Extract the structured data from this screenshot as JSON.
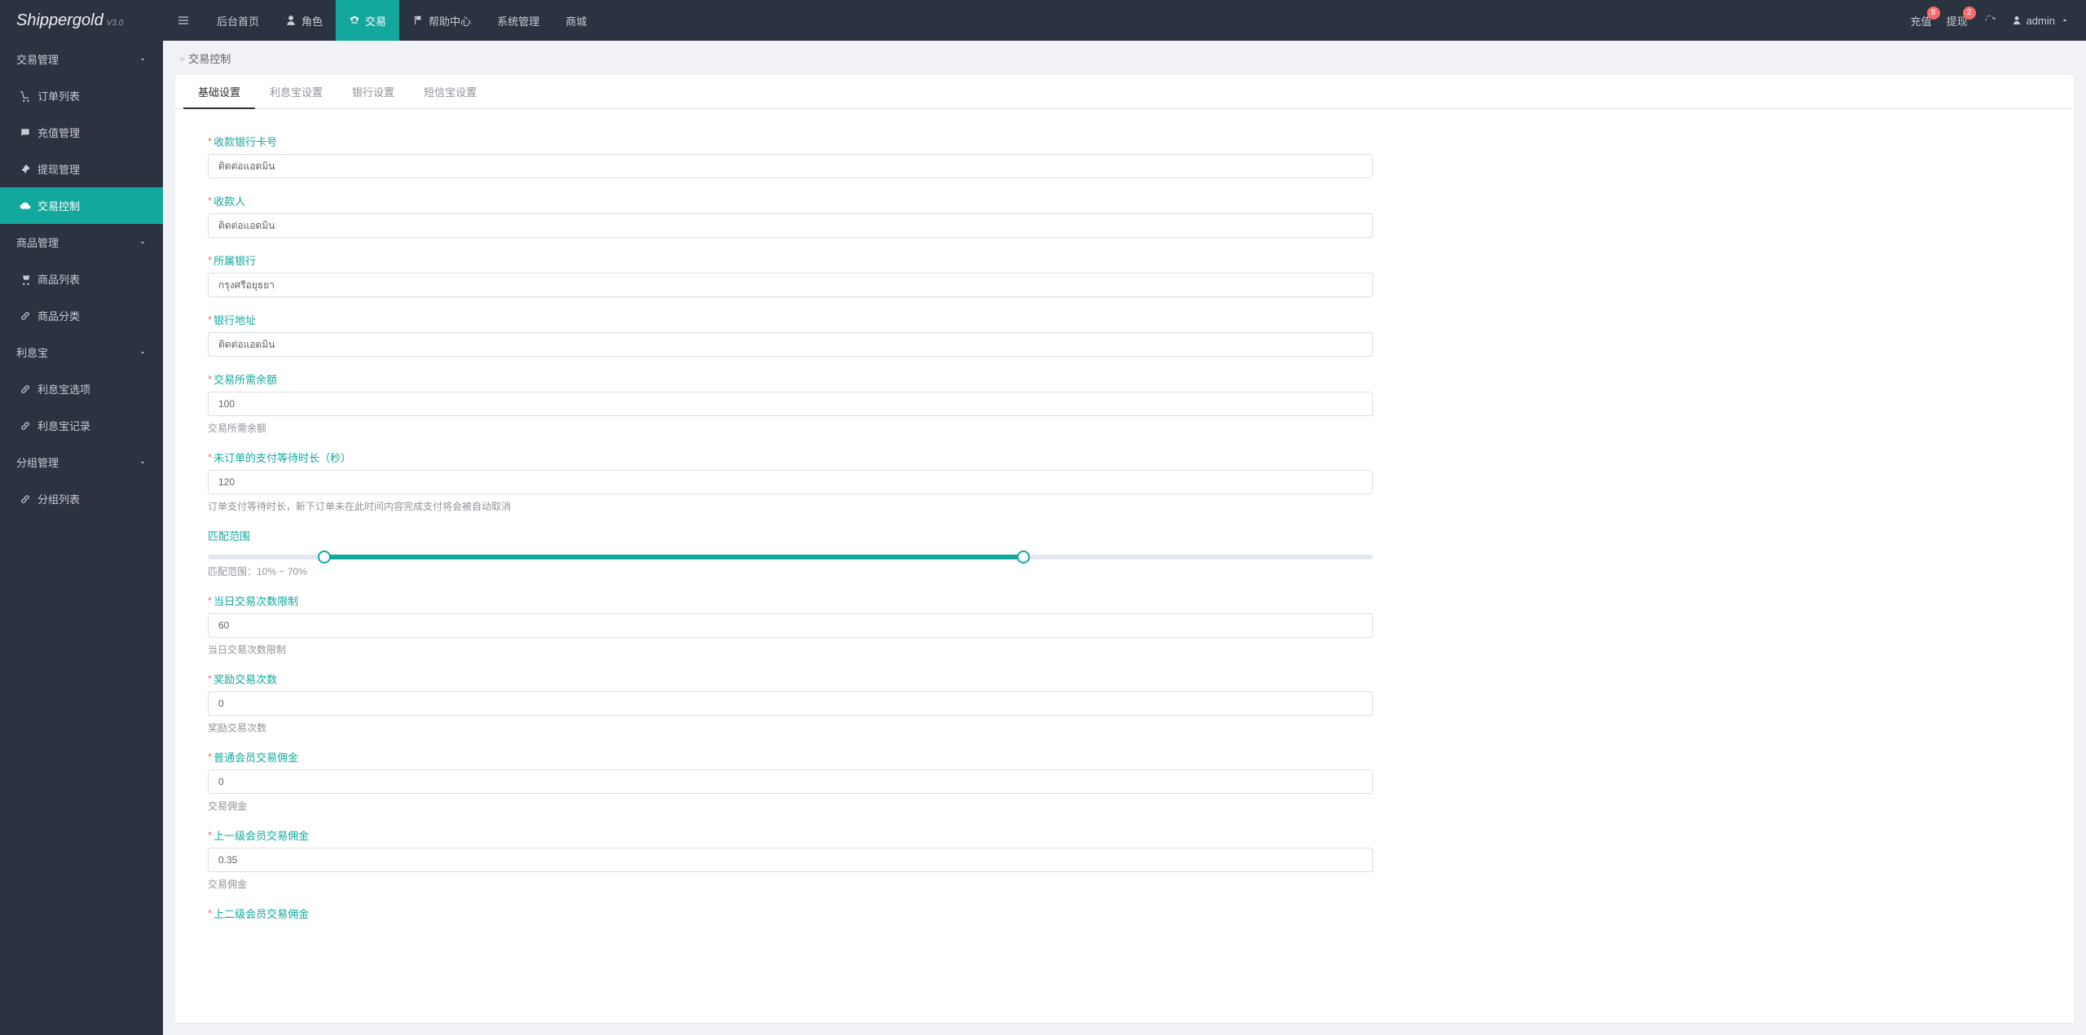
{
  "brand": {
    "name": "Shippergold",
    "version": "V3.0"
  },
  "topMenu": {
    "items": [
      {
        "label": "后台首页",
        "icon": ""
      },
      {
        "label": "角色",
        "icon": "user"
      },
      {
        "label": "交易",
        "icon": "scale",
        "active": true
      },
      {
        "label": "帮助中心",
        "icon": "flag"
      },
      {
        "label": "系统管理",
        "icon": ""
      },
      {
        "label": "商城",
        "icon": ""
      }
    ]
  },
  "navRight": {
    "recharge": {
      "label": "充值",
      "badge": "8"
    },
    "withdraw": {
      "label": "提现",
      "badge": "2"
    },
    "user": "admin"
  },
  "sidebar": {
    "groups": [
      {
        "title": "交易管理",
        "items": [
          {
            "label": "订单列表",
            "icon": "cart"
          },
          {
            "label": "充值管理",
            "icon": "chat"
          },
          {
            "label": "提现管理",
            "icon": "pin"
          },
          {
            "label": "交易控制",
            "icon": "cloud",
            "active": true
          }
        ]
      },
      {
        "title": "商品管理",
        "items": [
          {
            "label": "商品列表",
            "icon": "cart2"
          },
          {
            "label": "商品分类",
            "icon": "link"
          }
        ]
      },
      {
        "title": "利息宝",
        "items": [
          {
            "label": "利息宝选项",
            "icon": "link"
          },
          {
            "label": "利息宝记录",
            "icon": "link"
          }
        ]
      },
      {
        "title": "分组管理",
        "items": [
          {
            "label": "分组列表",
            "icon": "link"
          }
        ]
      }
    ]
  },
  "breadcrumb": {
    "sep": "»",
    "current": "交易控制"
  },
  "tabs": [
    {
      "label": "基础设置",
      "active": true
    },
    {
      "label": "利息宝设置"
    },
    {
      "label": "银行设置"
    },
    {
      "label": "短信宝设置"
    }
  ],
  "form": {
    "bank_card": {
      "label": "收款银行卡号",
      "value": "ติดต่อแอดมิน",
      "required": true
    },
    "payee": {
      "label": "收款人",
      "value": "ติดต่อแอดมิน",
      "required": true
    },
    "bank": {
      "label": "所属银行",
      "value": "กรุงศรีอยุธยา",
      "required": true
    },
    "bank_addr": {
      "label": "银行地址",
      "value": "ติดต่อแอดมิน",
      "required": true
    },
    "min_balance": {
      "label": "交易所需余额",
      "value": "100",
      "required": true,
      "tip": "交易所需余额"
    },
    "wait_sec": {
      "label": "未订单的支付等待时长（秒）",
      "value": "120",
      "required": true,
      "tip": "订单支付等待时长，新下订单未在此时间内容完成支付将会被自动取消"
    },
    "range": {
      "label": "匹配范围",
      "min": 10,
      "max": 70,
      "track_max": 100,
      "tip": "匹配范围：10% ~ 70%"
    },
    "day_limit": {
      "label": "当日交易次数限制",
      "value": "60",
      "required": true,
      "tip": "当日交易次数限制"
    },
    "bonus_cnt": {
      "label": "奖励交易次数",
      "value": "0",
      "required": true,
      "tip": "奖励交易次数"
    },
    "normal_commission": {
      "label": "普通会员交易佣金",
      "value": "0",
      "required": true,
      "tip": "交易佣金"
    },
    "lv1_commission": {
      "label": "上一级会员交易佣金",
      "value": "0.35",
      "required": true,
      "tip": "交易佣金"
    },
    "lv2_commission": {
      "label": "上二级会员交易佣金",
      "required": true
    }
  }
}
